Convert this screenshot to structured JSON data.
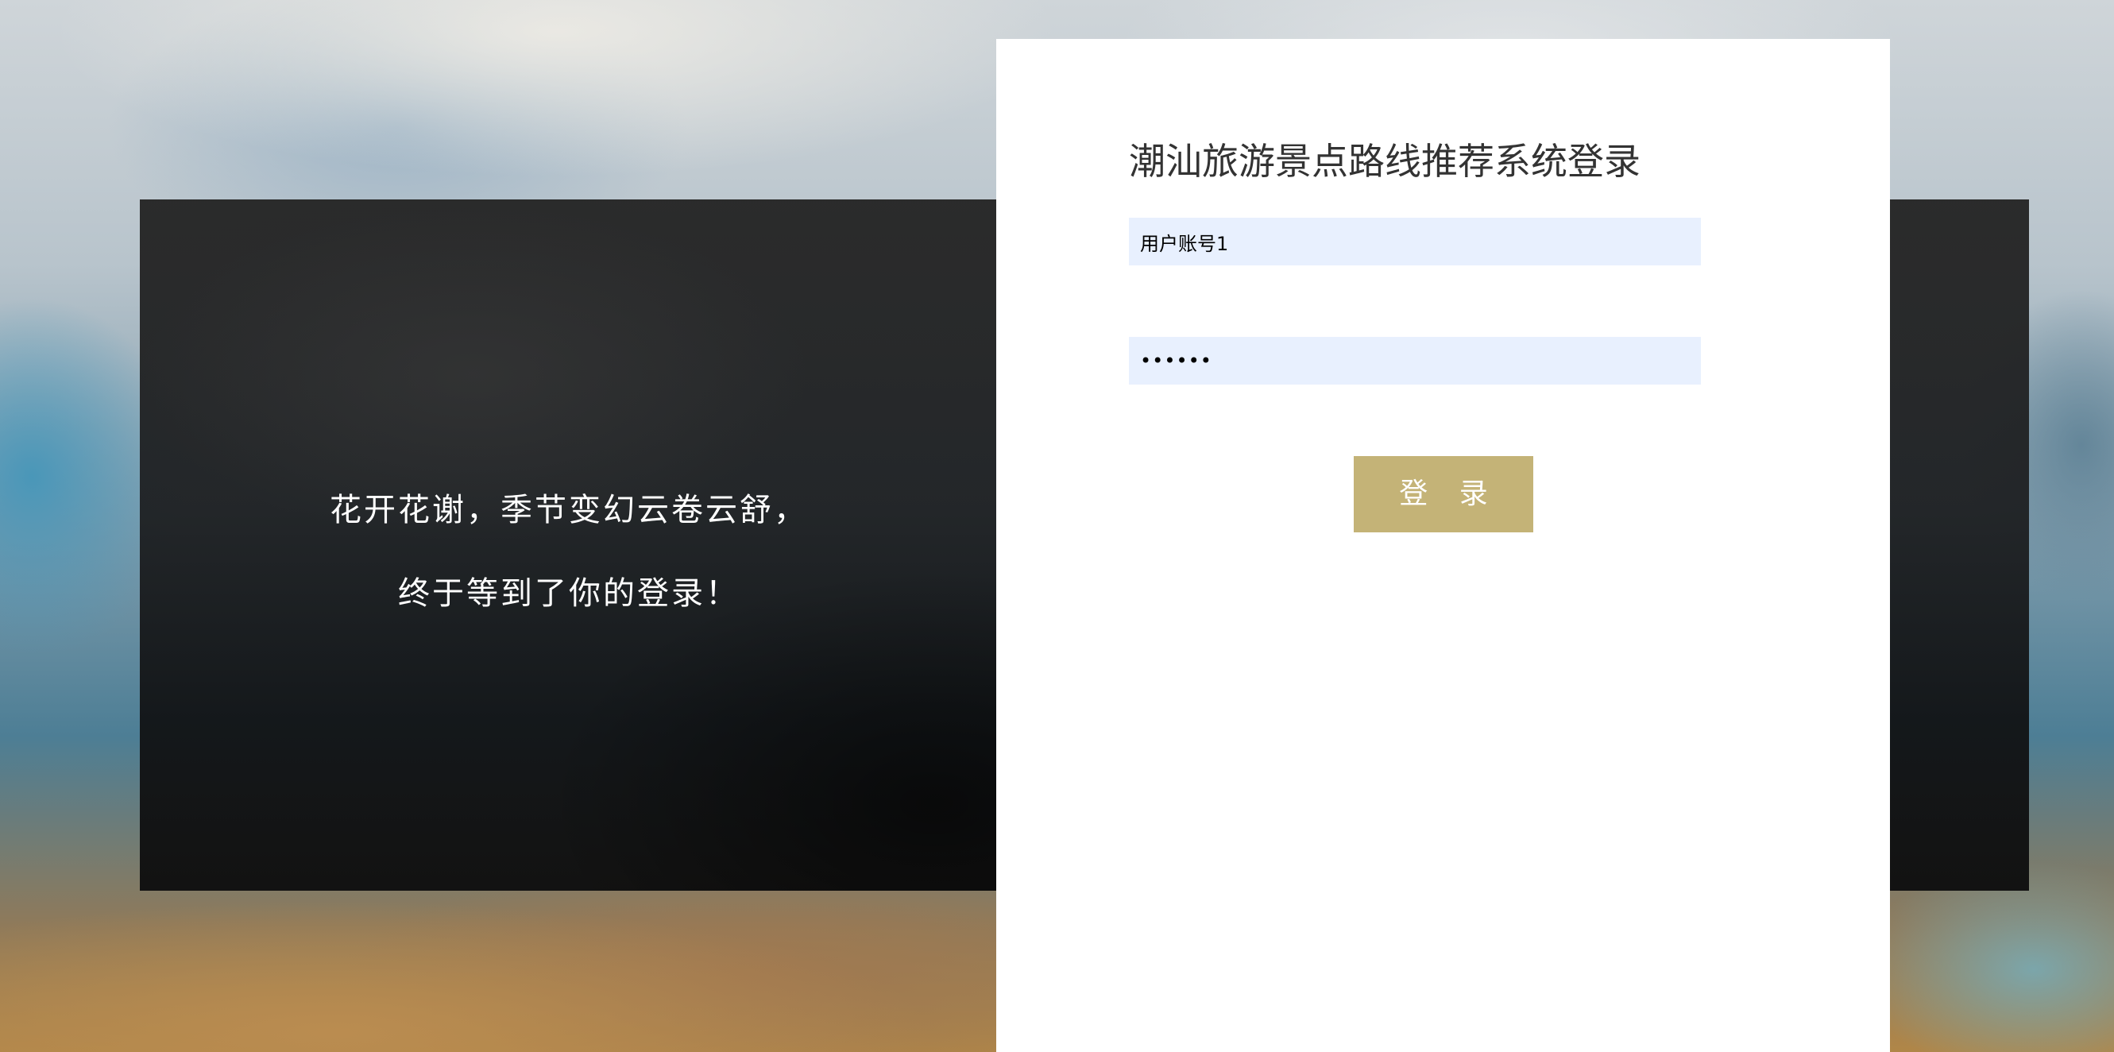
{
  "welcome": {
    "line1": "花开花谢，季节变幻云卷云舒，",
    "line2": "终于等到了你的登录！"
  },
  "login": {
    "title": "潮汕旅游景点路线推荐系统登录",
    "username_value": "用户账号1",
    "password_value": "••••••",
    "button_label": "登 录"
  },
  "colors": {
    "button": "#c4b377",
    "input_bg": "#e8f0fe",
    "card_bg": "#ffffff",
    "band_bg": "#262626"
  }
}
